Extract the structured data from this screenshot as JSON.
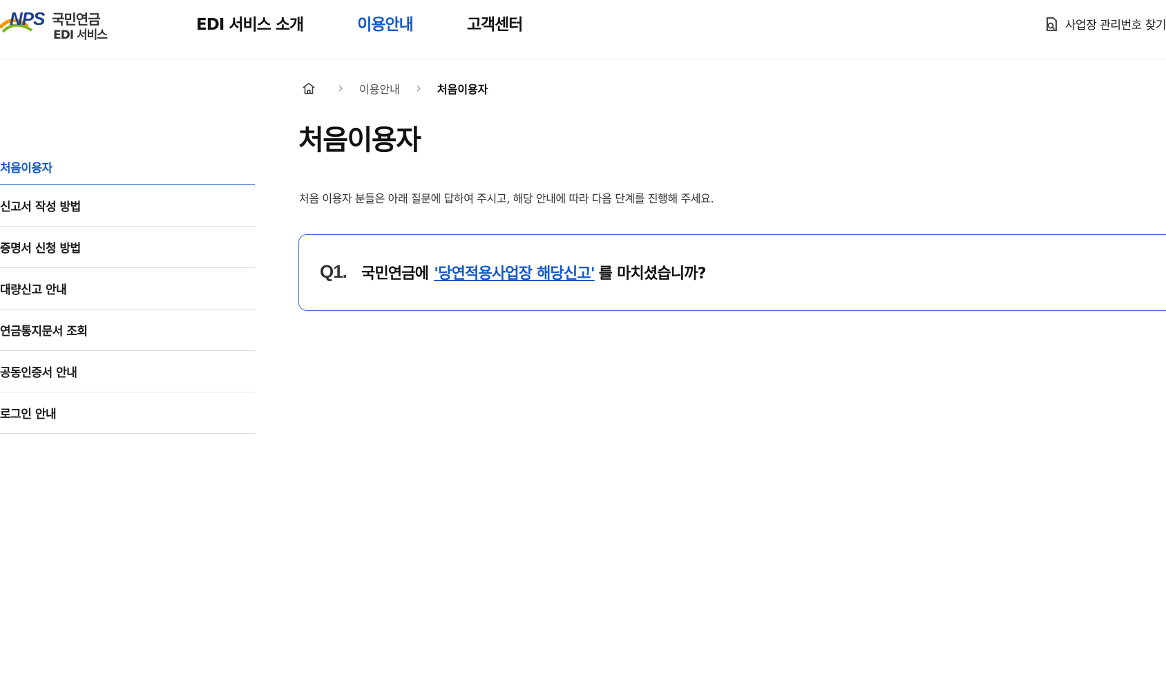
{
  "header": {
    "logo": {
      "nps": "NPS",
      "kr": "국민연금",
      "sub": "EDI 서비스"
    },
    "nav": [
      {
        "label": "EDI 서비스 소개",
        "active": false
      },
      {
        "label": "이용안내",
        "active": true
      },
      {
        "label": "고객센터",
        "active": false
      }
    ],
    "util_link": {
      "label": "사업장 관리번호 찾기",
      "icon": "search-document-icon"
    }
  },
  "sidebar": {
    "items": [
      {
        "label": "처음이용자",
        "active": true
      },
      {
        "label": "신고서 작성 방법",
        "active": false
      },
      {
        "label": "증명서 신청 방법",
        "active": false
      },
      {
        "label": "대량신고 안내",
        "active": false
      },
      {
        "label": "연금통지문서 조회",
        "active": false
      },
      {
        "label": "공동인증서 안내",
        "active": false
      },
      {
        "label": "로그인 안내",
        "active": false
      }
    ]
  },
  "breadcrumb": {
    "home_icon": "home-icon",
    "items": [
      "이용안내",
      "처음이용자"
    ]
  },
  "main": {
    "title": "처음이용자",
    "intro": "처음 이용자 분들은 아래 질문에 답하여 주시고, 해당 안내에 따라 다음 단계를 진행해 주세요.",
    "question": {
      "number": "Q1.",
      "prefix": "국민연금에",
      "link": "'당연적용사업장 해당신고'",
      "suffix": "를 마치셨습니까?"
    }
  },
  "colors": {
    "accent": "#1559c9",
    "border": "#dcdcdc",
    "question_border": "#3b6fd1"
  }
}
